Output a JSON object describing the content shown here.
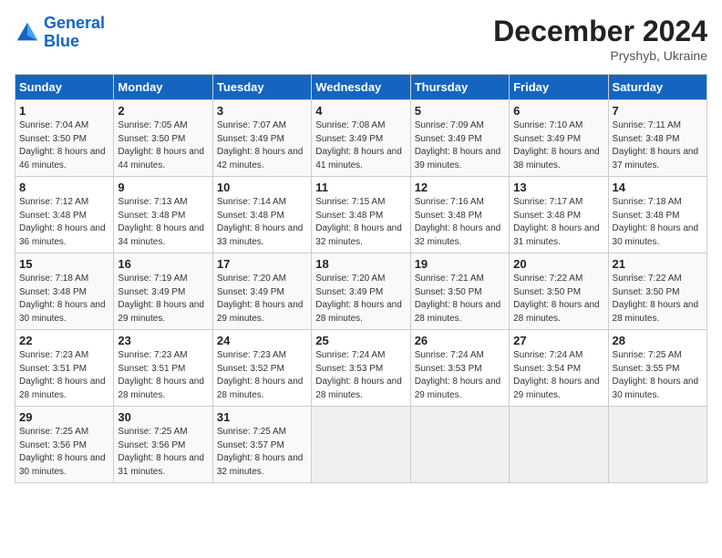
{
  "header": {
    "logo_line1": "General",
    "logo_line2": "Blue",
    "month_title": "December 2024",
    "location": "Pryshyb, Ukraine"
  },
  "weekdays": [
    "Sunday",
    "Monday",
    "Tuesday",
    "Wednesday",
    "Thursday",
    "Friday",
    "Saturday"
  ],
  "weeks": [
    [
      {
        "day": "1",
        "sunrise": "7:04 AM",
        "sunset": "3:50 PM",
        "daylight": "8 hours and 46 minutes."
      },
      {
        "day": "2",
        "sunrise": "7:05 AM",
        "sunset": "3:50 PM",
        "daylight": "8 hours and 44 minutes."
      },
      {
        "day": "3",
        "sunrise": "7:07 AM",
        "sunset": "3:49 PM",
        "daylight": "8 hours and 42 minutes."
      },
      {
        "day": "4",
        "sunrise": "7:08 AM",
        "sunset": "3:49 PM",
        "daylight": "8 hours and 41 minutes."
      },
      {
        "day": "5",
        "sunrise": "7:09 AM",
        "sunset": "3:49 PM",
        "daylight": "8 hours and 39 minutes."
      },
      {
        "day": "6",
        "sunrise": "7:10 AM",
        "sunset": "3:49 PM",
        "daylight": "8 hours and 38 minutes."
      },
      {
        "day": "7",
        "sunrise": "7:11 AM",
        "sunset": "3:48 PM",
        "daylight": "8 hours and 37 minutes."
      }
    ],
    [
      {
        "day": "8",
        "sunrise": "7:12 AM",
        "sunset": "3:48 PM",
        "daylight": "8 hours and 36 minutes."
      },
      {
        "day": "9",
        "sunrise": "7:13 AM",
        "sunset": "3:48 PM",
        "daylight": "8 hours and 34 minutes."
      },
      {
        "day": "10",
        "sunrise": "7:14 AM",
        "sunset": "3:48 PM",
        "daylight": "8 hours and 33 minutes."
      },
      {
        "day": "11",
        "sunrise": "7:15 AM",
        "sunset": "3:48 PM",
        "daylight": "8 hours and 32 minutes."
      },
      {
        "day": "12",
        "sunrise": "7:16 AM",
        "sunset": "3:48 PM",
        "daylight": "8 hours and 32 minutes."
      },
      {
        "day": "13",
        "sunrise": "7:17 AM",
        "sunset": "3:48 PM",
        "daylight": "8 hours and 31 minutes."
      },
      {
        "day": "14",
        "sunrise": "7:18 AM",
        "sunset": "3:48 PM",
        "daylight": "8 hours and 30 minutes."
      }
    ],
    [
      {
        "day": "15",
        "sunrise": "7:18 AM",
        "sunset": "3:48 PM",
        "daylight": "8 hours and 30 minutes."
      },
      {
        "day": "16",
        "sunrise": "7:19 AM",
        "sunset": "3:49 PM",
        "daylight": "8 hours and 29 minutes."
      },
      {
        "day": "17",
        "sunrise": "7:20 AM",
        "sunset": "3:49 PM",
        "daylight": "8 hours and 29 minutes."
      },
      {
        "day": "18",
        "sunrise": "7:20 AM",
        "sunset": "3:49 PM",
        "daylight": "8 hours and 28 minutes."
      },
      {
        "day": "19",
        "sunrise": "7:21 AM",
        "sunset": "3:50 PM",
        "daylight": "8 hours and 28 minutes."
      },
      {
        "day": "20",
        "sunrise": "7:22 AM",
        "sunset": "3:50 PM",
        "daylight": "8 hours and 28 minutes."
      },
      {
        "day": "21",
        "sunrise": "7:22 AM",
        "sunset": "3:50 PM",
        "daylight": "8 hours and 28 minutes."
      }
    ],
    [
      {
        "day": "22",
        "sunrise": "7:23 AM",
        "sunset": "3:51 PM",
        "daylight": "8 hours and 28 minutes."
      },
      {
        "day": "23",
        "sunrise": "7:23 AM",
        "sunset": "3:51 PM",
        "daylight": "8 hours and 28 minutes."
      },
      {
        "day": "24",
        "sunrise": "7:23 AM",
        "sunset": "3:52 PM",
        "daylight": "8 hours and 28 minutes."
      },
      {
        "day": "25",
        "sunrise": "7:24 AM",
        "sunset": "3:53 PM",
        "daylight": "8 hours and 28 minutes."
      },
      {
        "day": "26",
        "sunrise": "7:24 AM",
        "sunset": "3:53 PM",
        "daylight": "8 hours and 29 minutes."
      },
      {
        "day": "27",
        "sunrise": "7:24 AM",
        "sunset": "3:54 PM",
        "daylight": "8 hours and 29 minutes."
      },
      {
        "day": "28",
        "sunrise": "7:25 AM",
        "sunset": "3:55 PM",
        "daylight": "8 hours and 30 minutes."
      }
    ],
    [
      {
        "day": "29",
        "sunrise": "7:25 AM",
        "sunset": "3:56 PM",
        "daylight": "8 hours and 30 minutes."
      },
      {
        "day": "30",
        "sunrise": "7:25 AM",
        "sunset": "3:56 PM",
        "daylight": "8 hours and 31 minutes."
      },
      {
        "day": "31",
        "sunrise": "7:25 AM",
        "sunset": "3:57 PM",
        "daylight": "8 hours and 32 minutes."
      },
      null,
      null,
      null,
      null
    ]
  ],
  "labels": {
    "sunrise": "Sunrise: ",
    "sunset": "Sunset: ",
    "daylight": "Daylight: "
  }
}
